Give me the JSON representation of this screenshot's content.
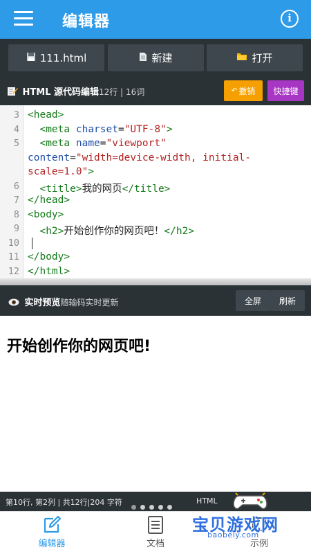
{
  "app": {
    "title": "编辑器"
  },
  "toolbar": {
    "file_label": "111.html",
    "new_label": "新建",
    "open_label": "打开"
  },
  "editor": {
    "header": "HTML 源代码编辑",
    "stats": "12行 | 16词",
    "undo_label": "撤销",
    "shortcuts_label": "快捷键"
  },
  "code": {
    "lines": [
      {
        "num": "3",
        "parts": [
          [
            "tag",
            "<head>"
          ]
        ]
      },
      {
        "num": "4",
        "parts": [
          [
            "plain",
            "  "
          ],
          [
            "tag",
            "<meta "
          ],
          [
            "attr",
            "charset"
          ],
          [
            "plain",
            "="
          ],
          [
            "str",
            "\"UTF-8\""
          ],
          [
            "tag",
            ">"
          ]
        ]
      },
      {
        "num": "5",
        "parts": [
          [
            "plain",
            "  "
          ],
          [
            "tag",
            "<meta "
          ],
          [
            "attr",
            "name"
          ],
          [
            "plain",
            "="
          ],
          [
            "str",
            "\"viewport\""
          ]
        ]
      },
      {
        "num": "",
        "parts": [
          [
            "attr",
            "content"
          ],
          [
            "plain",
            "="
          ],
          [
            "str",
            "\"width=device-width, initial-"
          ]
        ]
      },
      {
        "num": "",
        "parts": [
          [
            "str",
            "scale=1.0\""
          ],
          [
            "tag",
            ">"
          ]
        ]
      },
      {
        "num": "6",
        "parts": [
          [
            "plain",
            "  "
          ],
          [
            "tag",
            "<title>"
          ],
          [
            "plain",
            "我的网页"
          ],
          [
            "tag",
            "</title>"
          ]
        ]
      },
      {
        "num": "7",
        "parts": [
          [
            "tag",
            "</head>"
          ]
        ]
      },
      {
        "num": "8",
        "parts": [
          [
            "tag",
            "<body>"
          ]
        ]
      },
      {
        "num": "9",
        "parts": [
          [
            "plain",
            "  "
          ],
          [
            "tag",
            "<h2>"
          ],
          [
            "plain",
            "开始创作你的网页吧！"
          ],
          [
            "tag",
            "</h2>"
          ]
        ]
      },
      {
        "num": "10",
        "parts": []
      },
      {
        "num": "11",
        "parts": [
          [
            "tag",
            "</body>"
          ]
        ]
      },
      {
        "num": "12",
        "parts": [
          [
            "tag",
            "</html>"
          ]
        ]
      }
    ]
  },
  "preview": {
    "header": "实时预览",
    "subheader": "随输码实时更新",
    "fullscreen_label": "全屏",
    "refresh_label": "刷新",
    "content_heading": "开始创作你的网页吧!"
  },
  "status": {
    "position": "第10行, 第2列 | 共12行|204 字符",
    "mode": "HTML"
  },
  "nav": {
    "items": [
      {
        "label": "编辑器",
        "active": true
      },
      {
        "label": "文档",
        "active": false
      },
      {
        "label": "示例",
        "active": false
      }
    ]
  },
  "watermark": {
    "text": "宝贝游戏网",
    "url": "baobeiy.com"
  },
  "colors": {
    "primary": "#2e9be8",
    "dark": "#2b3236",
    "undo": "#f5a000",
    "shortcuts": "#a836c4"
  }
}
